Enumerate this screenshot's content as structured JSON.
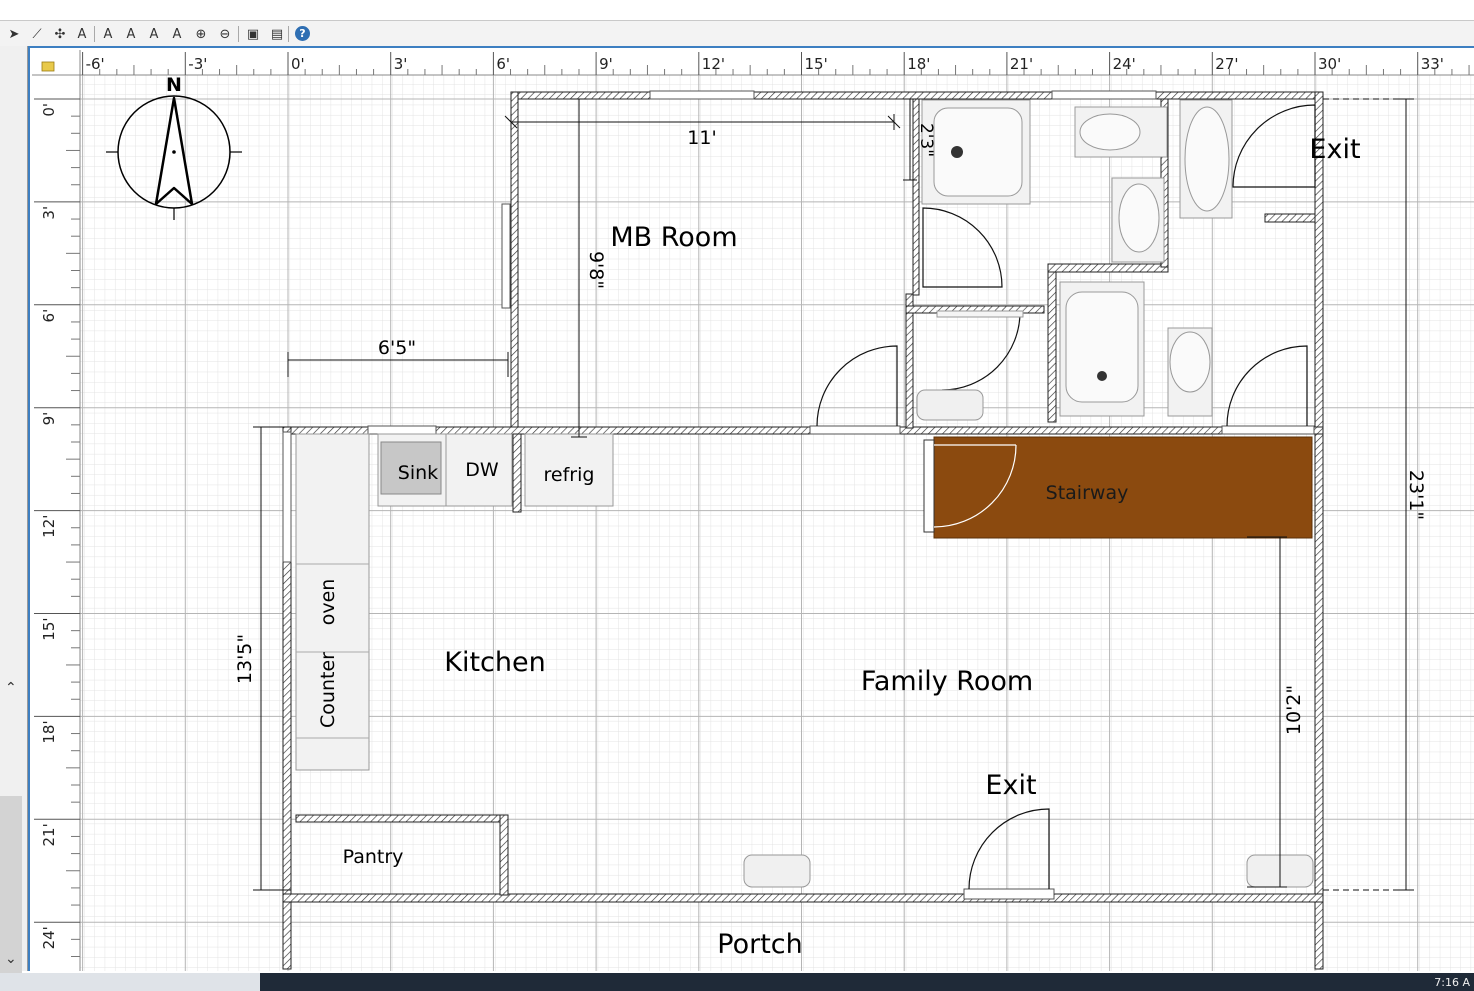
{
  "toolbar": {
    "buttons": [
      {
        "icon": "select-arrow-icon",
        "glyph": "➤"
      },
      {
        "icon": "create-walls-icon",
        "glyph": "⟋"
      },
      {
        "icon": "create-rooms-icon",
        "glyph": "✣"
      },
      {
        "icon": "add-text-icon",
        "glyph": "A"
      },
      {
        "icon": "increase-text-size-icon",
        "glyph": "A"
      },
      {
        "icon": "decrease-text-size-icon",
        "glyph": "A"
      },
      {
        "icon": "bold-text-icon",
        "glyph": "A"
      },
      {
        "icon": "italic-text-icon",
        "glyph": "A"
      },
      {
        "icon": "zoom-in-icon",
        "glyph": "⊕"
      },
      {
        "icon": "zoom-out-icon",
        "glyph": "⊖"
      },
      {
        "icon": "create-photo-icon",
        "glyph": "▣"
      },
      {
        "icon": "create-video-icon",
        "glyph": "▤"
      },
      {
        "icon": "help-icon",
        "glyph": "?"
      }
    ]
  },
  "rulers": {
    "horizontal": [
      "-6'",
      "-3'",
      "0'",
      "3'",
      "6'",
      "9'",
      "12'",
      "15'",
      "18'",
      "21'",
      "24'",
      "27'",
      "30'",
      "33'"
    ],
    "vertical": [
      "0'",
      "3'",
      "6'",
      "9'",
      "12'",
      "15'",
      "18'",
      "21'",
      "24'"
    ]
  },
  "compass": {
    "north_label": "N"
  },
  "rooms": {
    "mb_room": "MB Room",
    "kitchen": "Kitchen",
    "family_room": "Family Room",
    "portch": "Portch",
    "pantry": "Pantry",
    "exit_top": "Exit",
    "exit_bottom": "Exit"
  },
  "furniture": {
    "sink": "Sink",
    "dw": "DW",
    "refrig": "refrig",
    "oven": "oven",
    "counter": "Counter",
    "stairway": "Stairway"
  },
  "dimensions": {
    "mb_width": "11'",
    "mb_height": "9'8\"",
    "bath_small": "2'3\"",
    "left_offset": "6'5\"",
    "kitchen_height": "13'5\"",
    "right_height": "10'2\"",
    "overall_height": "23'1\""
  },
  "colors": {
    "stairway": "#8b4a0f",
    "accent_blue": "#3d7fc1",
    "wall_hatch": "#333333"
  },
  "taskbar": {
    "clock": "7:16 A"
  }
}
